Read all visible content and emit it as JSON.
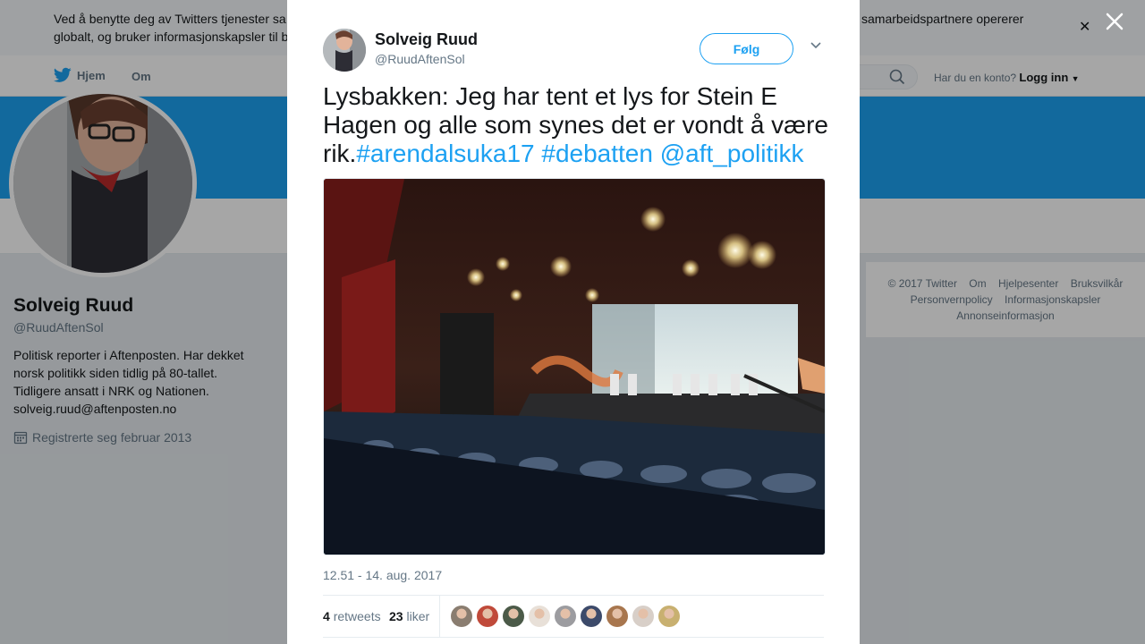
{
  "cookie_bar": {
    "left_line1": "Ved å benytte deg av Twitters tjenester sa",
    "left_line2": "globalt, og bruker informasjonskapsler til b",
    "right_line1": "samarbeidspartnere opererer"
  },
  "topnav": {
    "home_label": "Hjem",
    "about_label": "Om",
    "login_prompt": "Har du en konto?",
    "login_label": "Logg inn"
  },
  "profile": {
    "name": "Solveig Ruud",
    "handle": "@RuudAftenSol",
    "bio_lines": [
      "Politisk reporter i Aftenposten. Har dekket",
      "norsk politikk siden tidlig på 80-tallet.",
      "Tidligere ansatt i NRK og Nationen.",
      "solveig.ruud@aftenposten.no"
    ],
    "joined": "Registrerte seg februar 2013"
  },
  "footer": {
    "line1": [
      "© 2017 Twitter",
      "Om",
      "Hjelpesenter",
      "Bruksvilkår"
    ],
    "line2": [
      "Personvernpolicy",
      "Informasjonskapsler"
    ],
    "line3": [
      "Annonseinformasjon"
    ]
  },
  "tweet": {
    "author_name": "Solveig Ruud",
    "author_handle": "@RuudAftenSol",
    "follow_label": "Følg",
    "text_plain": "Lysbakken: Jeg har tent et lys for Stein E Hagen og alle som synes det er vondt å være rik.",
    "hashtag1": "#arendalsuka17",
    "hashtag2": "#debatten",
    "mention": "@aft_politikk",
    "timestamp": "12.51 - 14. aug. 2017",
    "retweets_count": "4",
    "retweets_label": "retweets",
    "likes_count": "23",
    "likes_label": "liker",
    "liker_colors": [
      "#8a7d70",
      "#c04a3a",
      "#4b5a48",
      "#e8e0d8",
      "#9c9ca0",
      "#3c4a6a",
      "#a8764e",
      "#d8cfc8",
      "#c8b070"
    ]
  },
  "colors": {
    "accent": "#1da1f2",
    "banner": "#1da1f2"
  }
}
